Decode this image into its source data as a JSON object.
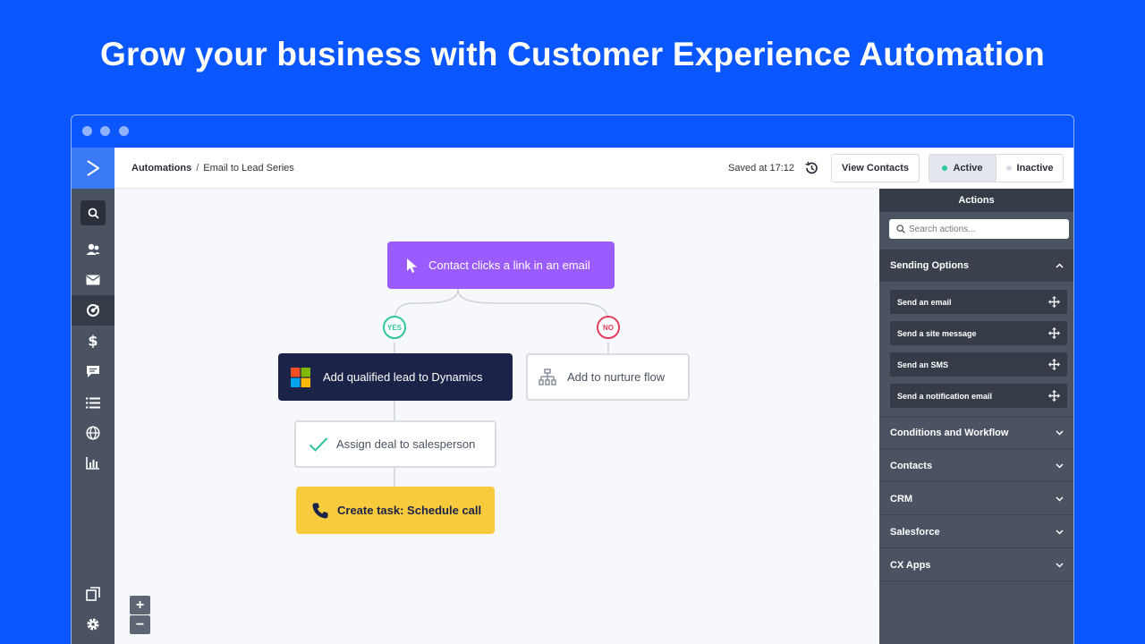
{
  "hero": {
    "title": "Grow your business with Customer Experience Automation"
  },
  "header": {
    "breadcrumb_root": "Automations",
    "breadcrumb_sep": "/",
    "breadcrumb_current": "Email to Lead Series",
    "saved_text": "Saved at 17:12",
    "view_contacts": "View Contacts",
    "status_active": "Active",
    "status_inactive": "Inactive"
  },
  "colors": {
    "brand_blue": "#0a56ff",
    "trigger_purple": "#9b5cff",
    "dynamics_navy": "#1c2348",
    "task_yellow": "#f8ca3e",
    "yes_green": "#2ec4a0",
    "no_red": "#e23c5e"
  },
  "sidebar": {
    "icons": [
      "logo-chevron-icon",
      "search-icon",
      "contacts-icon",
      "email-icon",
      "automation-icon",
      "dollar-icon",
      "chat-icon",
      "list-icon",
      "globe-icon",
      "reports-icon",
      "pages-icon",
      "settings-icon"
    ]
  },
  "flow": {
    "trigger": "Contact clicks a link in an email",
    "yes": "YES",
    "no": "NO",
    "dynamics": "Add qualified lead to Dynamics",
    "nurture": "Add to nurture flow",
    "assign": "Assign deal to salesperson",
    "task": "Create task: Schedule call",
    "zoom_in": "+",
    "zoom_out": "−"
  },
  "actions": {
    "title": "Actions",
    "search_placeholder": "Search actions...",
    "sending_options": "Sending Options",
    "items": [
      "Send an email",
      "Send a site message",
      "Send an SMS",
      "Send a notification email"
    ],
    "sections": [
      "Conditions and Workflow",
      "Contacts",
      "CRM",
      "Salesforce",
      "CX Apps"
    ]
  }
}
